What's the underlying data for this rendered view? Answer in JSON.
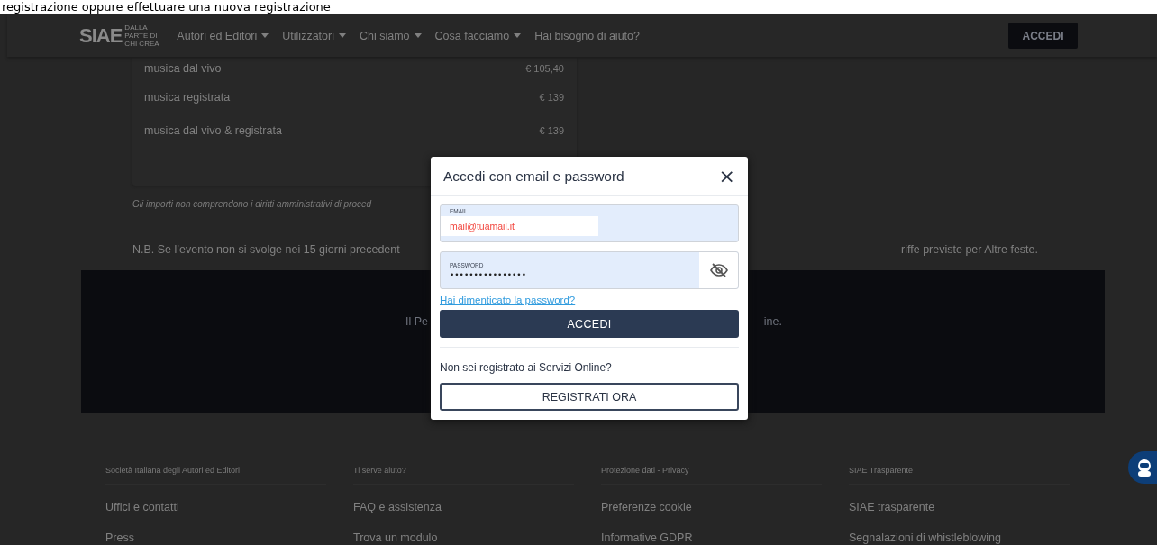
{
  "caption": "registrazione oppure effettuare una nuova registrazione",
  "nav": {
    "logo": "SIAE",
    "logo_tagline": "DALLA PARTE DI CHI CREA",
    "items": [
      {
        "label": "Autori ed Editori",
        "dropdown": true
      },
      {
        "label": "Utilizzatori",
        "dropdown": true
      },
      {
        "label": "Chi siamo",
        "dropdown": true
      },
      {
        "label": "Cosa facciamo",
        "dropdown": true
      },
      {
        "label": "Hai bisogno di aiuto?",
        "dropdown": false
      }
    ],
    "login_button": "ACCEDI"
  },
  "tariffs": {
    "rows": [
      {
        "label": "musica dal vivo",
        "price": "€ 105,40"
      },
      {
        "label": "musica registrata",
        "price": "€ 139"
      },
      {
        "label": "musica dal vivo & registrata",
        "price": "€ 139"
      }
    ],
    "note": "Gli importi non comprendono i diritti amministrativi di proced",
    "nb_left": "N.B. Se l’evento non si svolge nei 15 giorni precedent",
    "nb_right": "riffe previste per Altre feste."
  },
  "banner": {
    "left": "Il Pe",
    "right": "ine."
  },
  "footer": {
    "columns": [
      {
        "heading": "Società Italiana degli Autori ed Editori",
        "links": [
          "Uffici e contatti",
          "Press"
        ]
      },
      {
        "heading": "Ti serve aiuto?",
        "links": [
          "FAQ e assistenza",
          "Trova un modulo"
        ]
      },
      {
        "heading": "Protezione dati - Privacy",
        "links": [
          "Preferenze cookie",
          "Informative GDPR"
        ]
      },
      {
        "heading": "SIAE Trasparente",
        "links": [
          "SIAE trasparente",
          "Segnalazioni di whistleblowing"
        ]
      }
    ]
  },
  "modal": {
    "title": "Accedi con email e password",
    "close": "×",
    "email": {
      "label": "EMAIL",
      "value": "mail@tuamail.it"
    },
    "password": {
      "label": "PASSWORD",
      "value": "••••••••••••••••",
      "visible": false
    },
    "forgot_link": "Hai dimenticato la password?",
    "login_button": "ACCEDI",
    "register_prompt": "Non sei registrato ai Servizi Online?",
    "register_button": "REGISTRATI ORA"
  }
}
